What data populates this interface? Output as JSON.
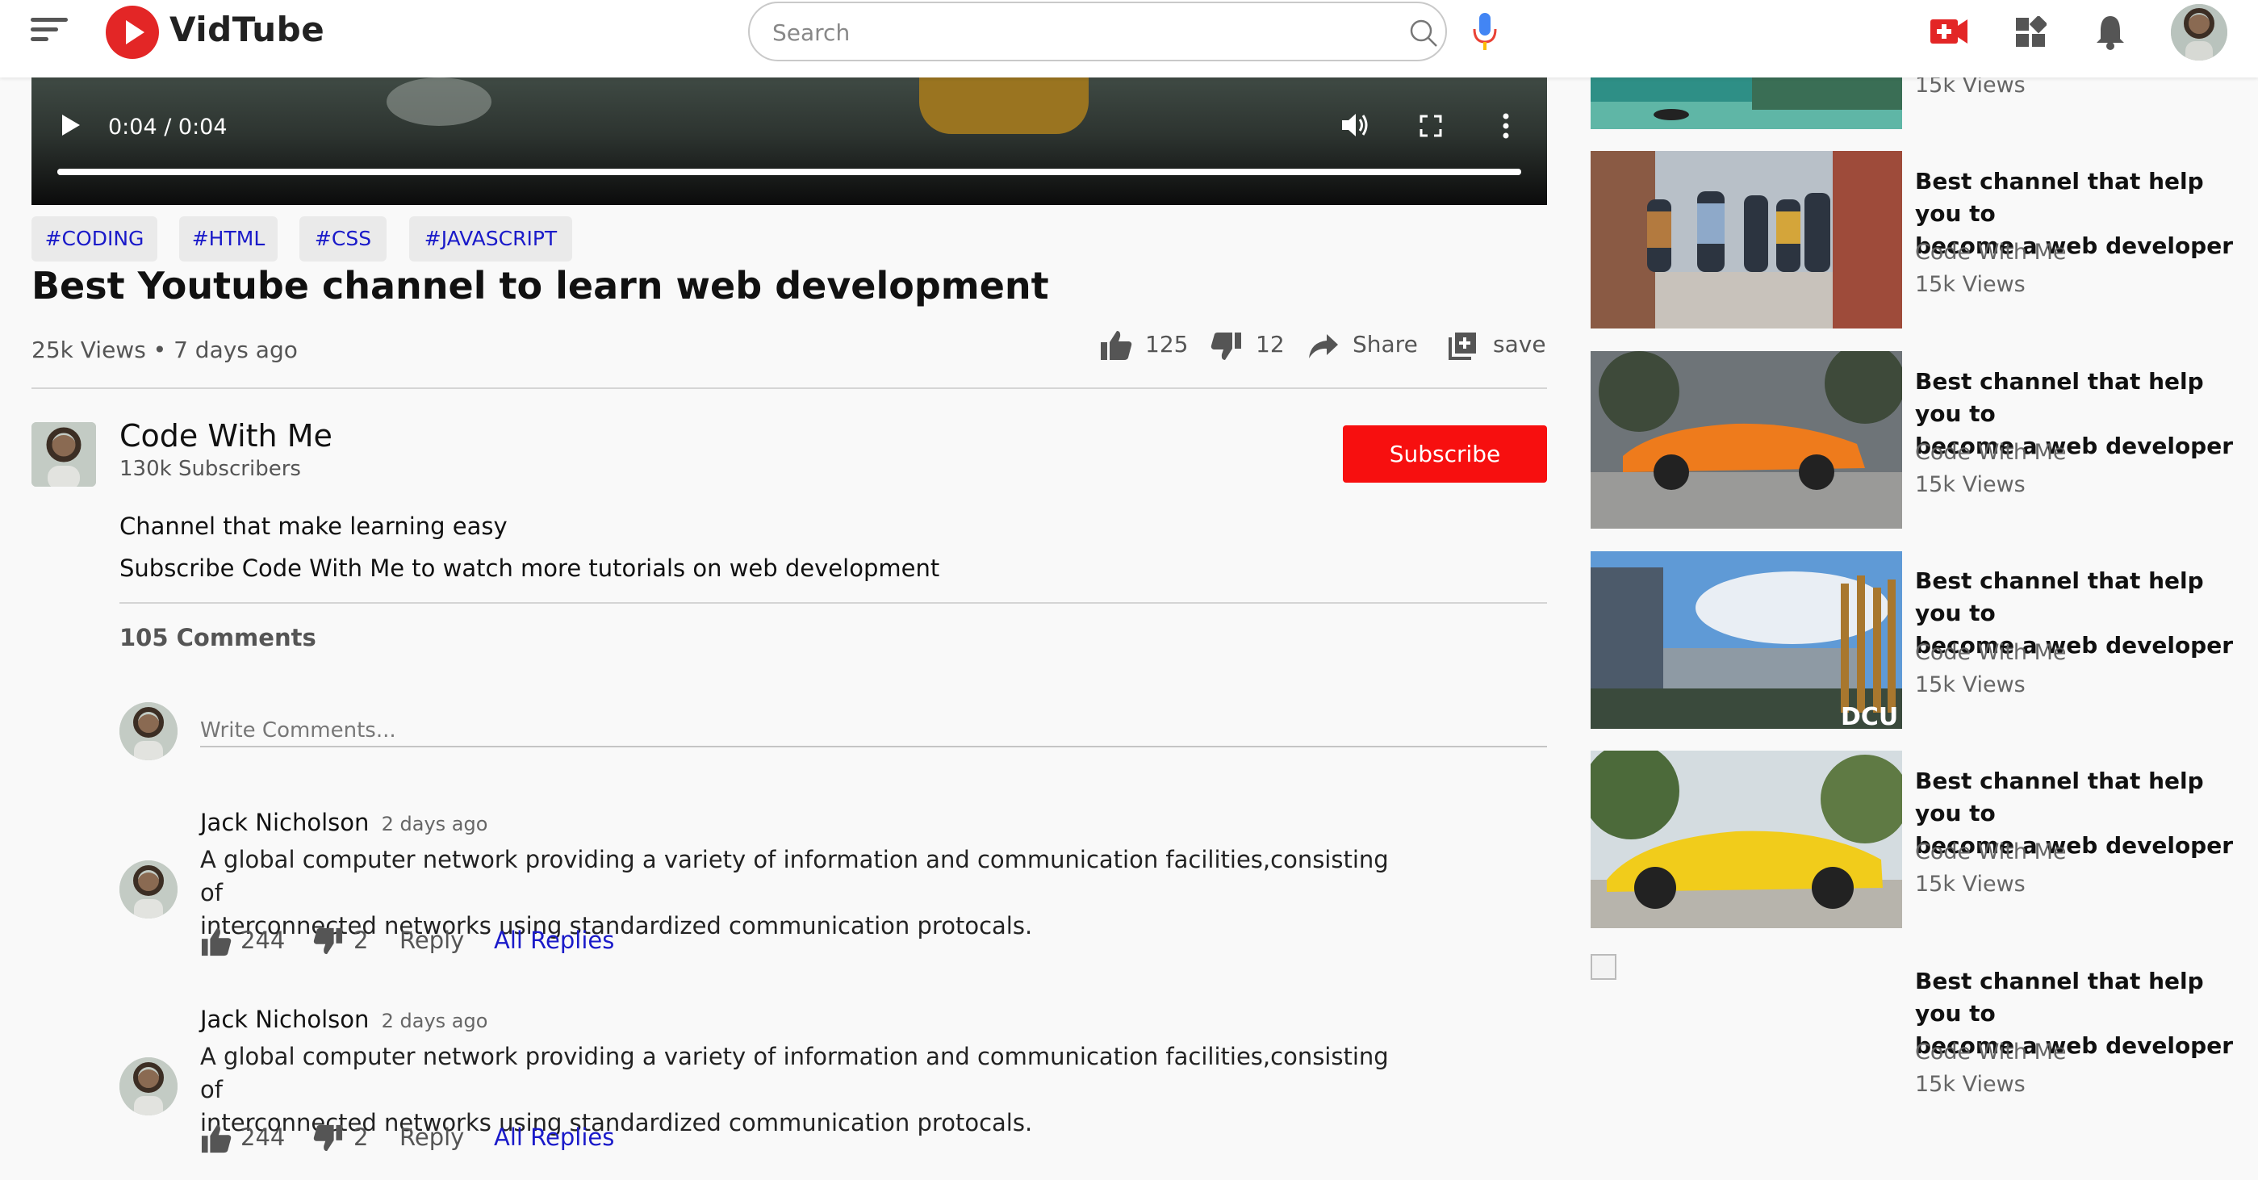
{
  "app": {
    "name": "VidTube"
  },
  "search": {
    "placeholder": "Search"
  },
  "player": {
    "time": "0:04 / 0:04",
    "progress": 1.0
  },
  "tags": [
    "#CODING",
    "#HTML",
    "#CSS",
    "#JAVASCRIPT"
  ],
  "video": {
    "title": "Best Youtube channel to learn web development",
    "meta": "25k Views • 7 days ago",
    "likes": "125",
    "dislikes": "12",
    "share_label": "Share",
    "save_label": "save"
  },
  "channel": {
    "name": "Code With Me",
    "subscribers": "130k Subscribers",
    "subscribe_label": "Subscribe",
    "description_1": "Channel that make learning easy",
    "description_2": "Subscribe Code With Me to watch more tutorials on web development"
  },
  "comments": {
    "count": "105 Comments",
    "placeholder": "Write Comments...",
    "items": [
      {
        "author": "Jack Nicholson",
        "time": "2 days ago",
        "line1": "A global computer network providing a variety of information and communication facilities,consisting of",
        "line2": "interconnected networks using standardized communication protocals.",
        "likes": "244",
        "dislikes": "2",
        "reply": "Reply",
        "all_replies": "All Replies"
      },
      {
        "author": "Jack Nicholson",
        "time": "2 days ago",
        "line1": "A global computer network providing a variety of information and communication facilities,consisting of",
        "line2": "interconnected networks using standardized communication protocals.",
        "likes": "244",
        "dislikes": "2",
        "reply": "Reply",
        "all_replies": "All Replies"
      }
    ]
  },
  "sidebar": {
    "top_views": "15k Views",
    "items": [
      {
        "title1": "Best channel that help you to",
        "title2": "become a web developer",
        "channel": "Code With Me",
        "views": "15k Views",
        "thumb": "people-walking"
      },
      {
        "title1": "Best channel that help you to",
        "title2": "become a web developer",
        "channel": "Code With Me",
        "views": "15k Views",
        "thumb": "orange-car"
      },
      {
        "title1": "Best channel that help you to",
        "title2": "become a web developer",
        "channel": "Code With Me",
        "views": "15k Views",
        "thumb": "campus-building",
        "thumb_text": "DCU"
      },
      {
        "title1": "Best channel that help you to",
        "title2": "become a web developer",
        "channel": "Code With Me",
        "views": "15k Views",
        "thumb": "yellow-car"
      },
      {
        "title1": "Best channel that help you to",
        "title2": "become a web developer",
        "channel": "Code With Me",
        "views": "15k Views",
        "thumb": "broken-image"
      }
    ]
  },
  "colors": {
    "brand": "#e32626",
    "subscribe": "#f70f0f",
    "link": "#1a1ac9"
  }
}
